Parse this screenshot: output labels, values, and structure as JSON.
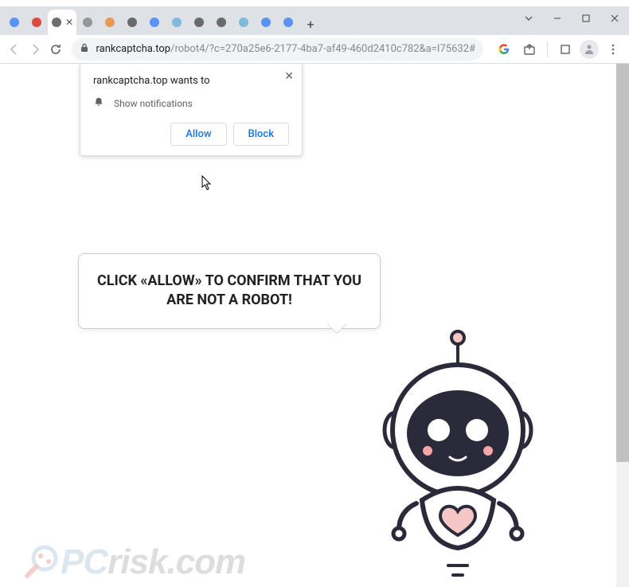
{
  "tabs": [
    {
      "title": "W",
      "color": "#4285f4"
    },
    {
      "title": "W",
      "color": "#d93025"
    },
    {
      "title": "t",
      "color": "#555"
    },
    {
      "title": "Tr",
      "color": "#888"
    },
    {
      "title": "D",
      "color": "#ea8b3d"
    },
    {
      "title": "h",
      "color": "#555"
    },
    {
      "title": "C",
      "color": "#4285f4"
    },
    {
      "title": "(1",
      "color": "#6fb3d8"
    },
    {
      "title": "H",
      "color": "#555"
    },
    {
      "title": "H",
      "color": "#555"
    },
    {
      "title": "(1",
      "color": "#6fb3d8"
    },
    {
      "title": "C",
      "color": "#4285f4"
    },
    {
      "title": "G",
      "color": "#4285f4"
    }
  ],
  "active_tab_index": 2,
  "omnibox": {
    "domain": "rankcaptcha.top",
    "path": "/robot4/?c=270a25e6-2177-4ba7-af49-460d2410c782&a=I75632#"
  },
  "permission_popup": {
    "title": "rankcaptcha.top wants to",
    "item": "Show notifications",
    "allow_label": "Allow",
    "block_label": "Block"
  },
  "speech_text": "CLICK «ALLOW» TO CONFIRM THAT YOU ARE NOT A ROBOT!",
  "watermark": {
    "pc": "PC",
    "risk": "risk.com"
  }
}
